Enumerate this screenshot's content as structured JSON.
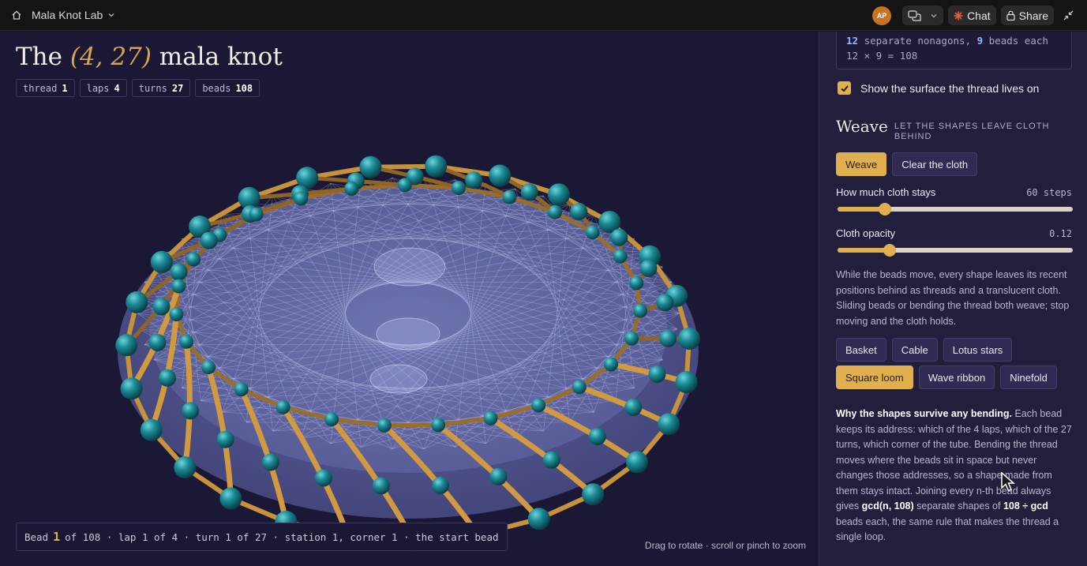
{
  "app": {
    "name": "Mala Knot Lab",
    "avatar_initials": "AP",
    "chat_label": "Chat",
    "share_label": "Share"
  },
  "title": {
    "prefix": "The",
    "tuple": "(4, 27)",
    "suffix": "mala knot"
  },
  "chips": [
    {
      "label": "thread",
      "value": "1"
    },
    {
      "label": "laps",
      "value": "4"
    },
    {
      "label": "turns",
      "value": "27"
    },
    {
      "label": "beads",
      "value": "108"
    }
  ],
  "status": {
    "prefix": "Bead",
    "bead": "1",
    "rest": "of 108 · lap 1 of 4 · turn 1 of 27 · station 1, corner 1 · the start bead"
  },
  "hint": "Drag to rotate · scroll or pinch to zoom",
  "panel": {
    "code_line1_num": "12",
    "code_line1_mid": "separate nonagons,",
    "code_line1_num2": "9",
    "code_line1_end": "beads each",
    "code_line2": "12 × 9 = 108",
    "surface_checkbox": {
      "label": "Show the surface the thread lives on",
      "checked": true
    },
    "weave": {
      "title": "Weave",
      "subtitle": "LET THE SHAPES LEAVE CLOTH BEHIND",
      "weave_button": "Weave",
      "clear_button": "Clear the cloth",
      "cloth_stays": {
        "label": "How much cloth stays",
        "value": "60 steps",
        "fraction": 0.2
      },
      "cloth_opacity": {
        "label": "Cloth opacity",
        "value": "0.12",
        "fraction": 0.22
      },
      "description": "While the beads move, every shape leaves its recent positions behind as threads and a translucent cloth. Sliding beads or bending the thread both weave; stop moving and the cloth holds."
    },
    "patterns": [
      "Basket",
      "Cable",
      "Lotus stars",
      "Square loom",
      "Wave ribbon",
      "Ninefold"
    ],
    "active_pattern": "Square loom",
    "why": {
      "heading": "Why the shapes survive any bending.",
      "text1": "Each bead keeps its address: which of the 4 laps, which of the 27 turns, which corner of the tube. Bending the thread moves where the beads sit in space but never changes those addresses, so a shape made from them stays intact. Joining every n-th bead always gives",
      "bold1": "gcd(n, 108)",
      "text2": "separate shapes of",
      "bold2": "108 ÷ gcd",
      "text3": "beads each, the same rule that makes the thread a single loop."
    }
  },
  "colors": {
    "accent": "#e0b04f",
    "bead": "#1f8a93",
    "thread": "#c8923a",
    "cloth": "#8c97e6",
    "background": "#1b1836"
  }
}
